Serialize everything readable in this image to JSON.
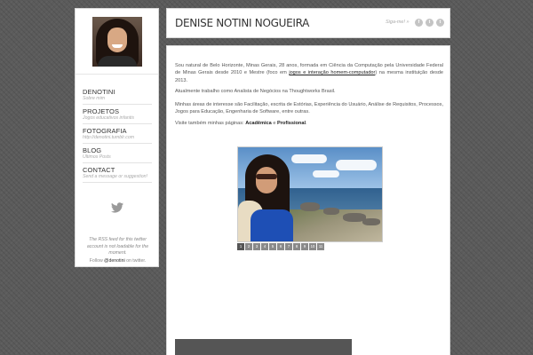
{
  "sidebar": {
    "nav": [
      {
        "title": "DENOTINI",
        "subtitle": "Sobre mim"
      },
      {
        "title": "PROJETOS",
        "subtitle": "Jogos educativos infantis"
      },
      {
        "title": "FOTOGRAFIA",
        "subtitle": "http://denotini.tumblr.com"
      },
      {
        "title": "BLOG",
        "subtitle": "Últimos Posts"
      },
      {
        "title": "CONTACT",
        "subtitle": "Send a message or suggestion!"
      }
    ],
    "twitter_note": "The RSS feed for this twitter account is not loadable for the moment.",
    "twitter_follow_prefix": "Follow",
    "twitter_handle": "@denotini",
    "twitter_follow_suffix": "on twitter."
  },
  "header": {
    "title": "DENISE NOTINI NOGUEIRA",
    "follow_label": "Siga-me! »",
    "social_icons": [
      "facebook-icon",
      "twitter-icon",
      "tumblr-icon"
    ]
  },
  "content": {
    "p1_a": "Sou natural de Belo Horizonte, Minas Gerais, 28 anos, formada em Ciência da Computação pela Universidade Federal de Minas Gerais desde 2010 e Mestre (foco em",
    "p1_link": "jogos e interação homem-computador",
    "p1_b": ") na mesma instituição desde 2013.",
    "p2": "Atualmente trabalho como Analista de Negócios na Thoughtworks Brasil.",
    "p3": "Minhas áreas de interesse são Facilitação, escrita de Estórias, Experiência do Usuário, Análise de Requisitos, Processos, Jogos para Educação, Engenharia de Software, entre outras.",
    "p4_prefix": "Visite também minhas páginas:",
    "p4_link1": "Acadêmica",
    "p4_and": "e",
    "p4_link2": "Profissional",
    "p4_end": "."
  },
  "gallery": {
    "pages": [
      "1",
      "2",
      "3",
      "4",
      "5",
      "6",
      "7",
      "8",
      "9",
      "10",
      "11"
    ],
    "active_page": "1"
  }
}
